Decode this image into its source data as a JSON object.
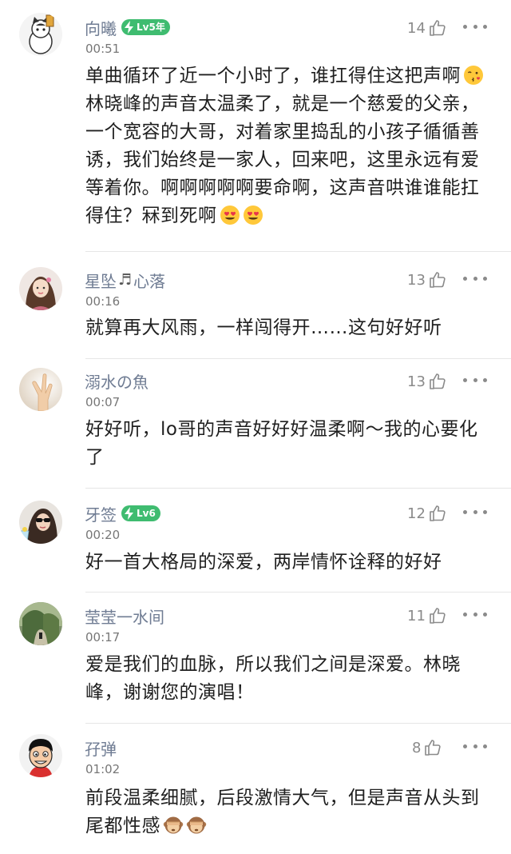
{
  "colors": {
    "username": "#6f7c93",
    "badge": "#3fbc70",
    "text": "#1f1f1f",
    "muted": "#8a8a8a"
  },
  "comments": [
    {
      "username": "向曦",
      "badge": "Lv5年",
      "time": "00:51",
      "likes": "14",
      "text": "单曲循环了近一个小时了，谁扛得住这把声啊",
      "text2": "林晓峰的声音太温柔了，就是一个慈爱的父亲，一个宽容的大哥，对着家里捣乱的小孩子循循善诱，我们始终是一家人，回来吧，这里永远有爱等着你。啊啊啊啊啊要命啊，这声音哄谁谁能扛得住？冧到死啊",
      "emoji": [
        "kissing-face",
        "heart-eyes-face",
        "heart-eyes-face"
      ]
    },
    {
      "username_a": "星坠",
      "username_b": "心落",
      "time": "00:16",
      "likes": "13",
      "text": "就算再大风雨，一样闯得开……这句好好听"
    },
    {
      "username": "溺水の魚",
      "time": "00:07",
      "likes": "13",
      "text": "好好听，lo哥的声音好好好温柔啊～我的心要化了"
    },
    {
      "username": "牙签",
      "badge": "Lv6",
      "time": "00:20",
      "likes": "12",
      "text": "好一首大格局的深爱，两岸情怀诠释的好好"
    },
    {
      "username": "莹莹一水间",
      "time": "00:17",
      "likes": "11",
      "text": "爱是我们的血脉，所以我们之间是深爱。林晓峰，谢谢您的演唱！"
    },
    {
      "username": "孖弹",
      "time": "01:02",
      "likes": "8",
      "text": "前段温柔细腻，后段激情大气，但是声音从头到尾都性感",
      "emoji": [
        "see-no-evil-monkey",
        "see-no-evil-monkey"
      ]
    }
  ]
}
